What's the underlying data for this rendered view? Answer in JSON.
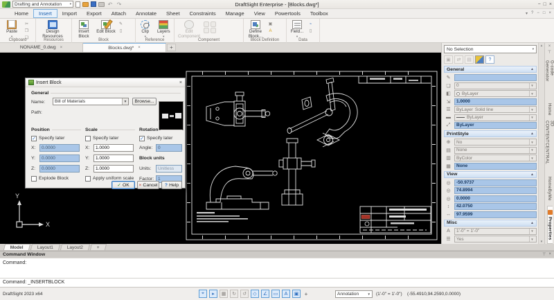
{
  "window": {
    "workspace": "Drafting and Annotation",
    "title": "DraftSight Enterprise - [Blocks.dwg*]"
  },
  "menu_tabs": [
    "Home",
    "Insert",
    "Import",
    "Export",
    "Attach",
    "Annotate",
    "Sheet",
    "Constraints",
    "Manage",
    "View",
    "Powertools",
    "Toolbox"
  ],
  "ribbon": {
    "clipboard": {
      "label": "Clipboard",
      "paste": "Paste"
    },
    "resources": {
      "label": "Resources",
      "design_resources": "Design Resources"
    },
    "block": {
      "label": "Block",
      "insert_block": "Insert Block",
      "edit_block": "Edit Block"
    },
    "reference": {
      "label": "Reference",
      "clip": "Clip",
      "layers": "Layers"
    },
    "component": {
      "label": "Component",
      "edit_component": "Edit Component"
    },
    "block_definition": {
      "label": "Block Definition",
      "define_block": "Define Block..."
    },
    "data_group": {
      "label": "Data",
      "field": "Field..."
    }
  },
  "doc_tabs": {
    "tab1": "NONAME_0.dwg",
    "tab2": "Blocks.dwg*"
  },
  "dialog": {
    "title": "Insert Block",
    "general": "General",
    "name_label": "Name:",
    "name_value": "Bill of Materials",
    "browse": "Browse...",
    "path_label": "Path:",
    "position": {
      "header": "Position",
      "specify": "Specify later",
      "x_label": "X:",
      "y_label": "Y:",
      "z_label": "Z:",
      "x": "0.0000",
      "y": "0.0000",
      "z": "0.0000",
      "explode": "Explode Block"
    },
    "scale": {
      "header": "Scale",
      "specify": "Specify later",
      "x_label": "X:",
      "y_label": "Y:",
      "z_label": "Z:",
      "x": "1.0000",
      "y": "1.0000",
      "z": "1.0000",
      "uniform": "Apply uniform scale"
    },
    "rotation": {
      "header": "Rotation",
      "specify": "Specify later",
      "angle_label": "Angle:",
      "angle": "0"
    },
    "block_units": {
      "header": "Block units",
      "units_label": "Units:",
      "units": "Unitless",
      "factor_label": "Factor:",
      "factor": "1"
    },
    "ok": "OK",
    "cancel": "Cancel",
    "help": "Help"
  },
  "properties": {
    "selection": "No Selection",
    "general": {
      "label": "General",
      "layer": "0",
      "line_color": "ByLayer",
      "line_scale": "1.0000",
      "line_style": "ByLayer",
      "line_style_desc": "Solid line",
      "line_weight": "ByLayer",
      "transparency": "ByLayer"
    },
    "print_style": {
      "label": "PrintStyle",
      "print": "No",
      "table": "None",
      "method": "ByColor",
      "style": "None"
    },
    "view": {
      "label": "View",
      "center_x": "-50.9737",
      "center_y": "74.8994",
      "center_z": "0.0000",
      "height": "42.0750",
      "width": "97.9599"
    },
    "misc": {
      "label": "Misc",
      "annotation_scale": "1'-0\" = 1'-0\"",
      "ucs_row": "Yes",
      "ucs_icon_row": "Yes"
    },
    "side_tabs": {
      "gcode": "G-code Generator",
      "home": "Home",
      "content_central": "3D CONTENTCENTRAL",
      "homebyme": "HomeByMe",
      "properties": "Properties"
    }
  },
  "sheet_tabs": {
    "model": "Model",
    "layout1": "Layout1",
    "layout2": "Layout2"
  },
  "command_window": {
    "title": "Command Window",
    "history": "Command:",
    "input": "Command: _INSERTBLOCK"
  },
  "status_bar": {
    "version": "DraftSight 2023 x64",
    "annotation": "Annotation",
    "scale": "(1'-0\" = 1'-0\")",
    "coordinates": "(-55.4910,94.2590,0.0000)"
  },
  "ucs": {
    "x_label": "X",
    "y_label": "Y"
  },
  "colors": {
    "accent": "#1a5dab",
    "canvas": "#000000",
    "highlight_field": "#a9c6e8"
  }
}
